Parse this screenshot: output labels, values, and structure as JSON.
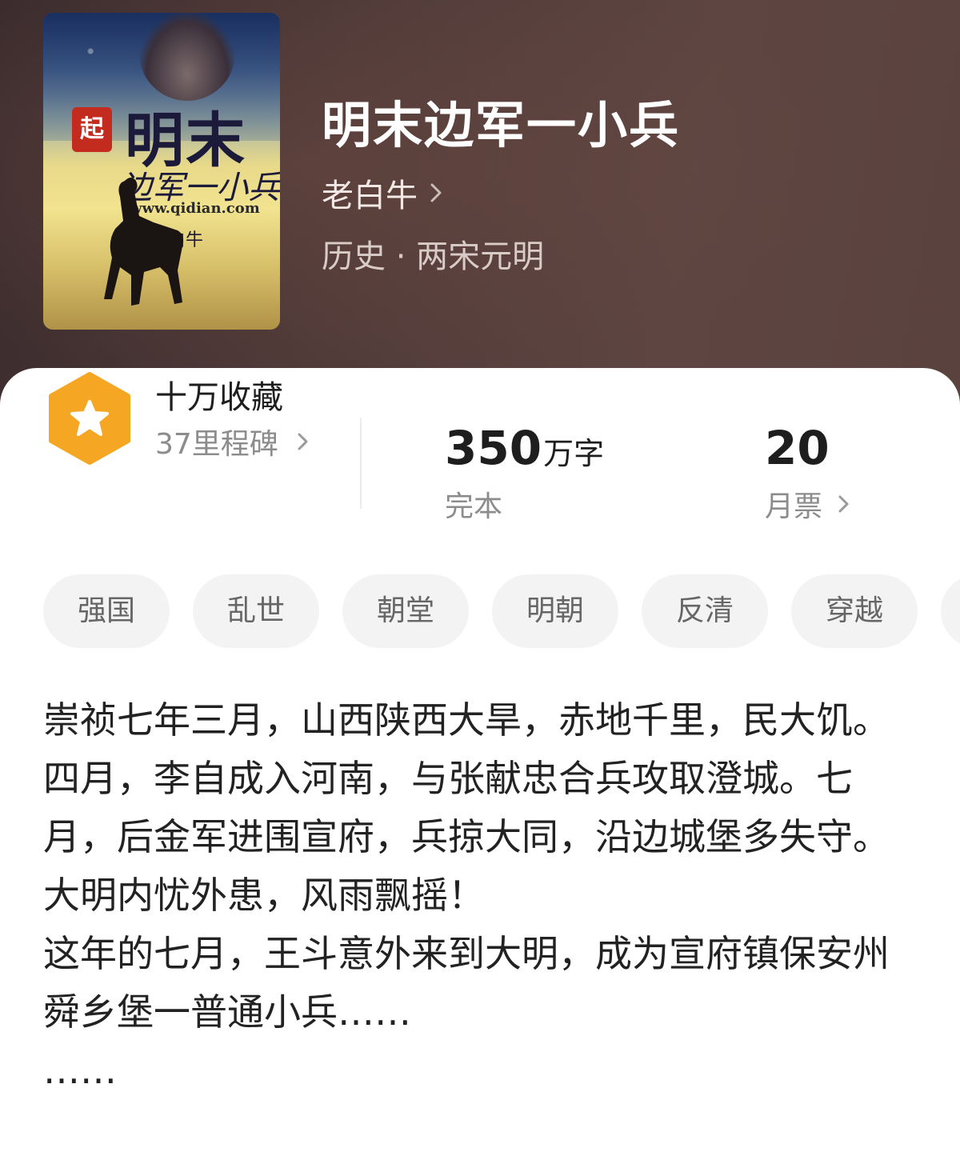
{
  "book": {
    "title": "明末边军一小兵",
    "author": "老白牛",
    "category": "历史 · 两宋元明",
    "cover": {
      "seal_text": "起",
      "title_big": "明末",
      "title_sub": "边军一小兵",
      "url": "www.qidian.com",
      "author": "老白牛"
    }
  },
  "stats": {
    "collection_title": "十万收藏",
    "milestone": "37里程碑",
    "word_count_number": "350",
    "word_count_unit": "万字",
    "status": "完本",
    "monthly_votes": "20",
    "monthly_votes_label": "月票"
  },
  "tags": [
    "强国",
    "乱世",
    "朝堂",
    "明朝",
    "反清",
    "穿越",
    ""
  ],
  "description": [
    "崇祯七年三月，山西陕西大旱，赤地千里，民大饥。四月，李自成入河南，与张献忠合兵攻取澄城。七月，后金军进围宣府，兵掠大同，沿边城堡多失守。",
    "大明内忧外患，风雨飘摇！",
    "这年的七月，王斗意外来到大明，成为宣府镇保安州舜乡堡一普通小兵……",
    "……"
  ],
  "colors": {
    "hero_bg": "#4f3a38",
    "badge": "#f5a623",
    "text_primary": "#1e1e1e",
    "text_secondary": "#8c8c8c",
    "tag_bg": "#f3f3f3"
  }
}
